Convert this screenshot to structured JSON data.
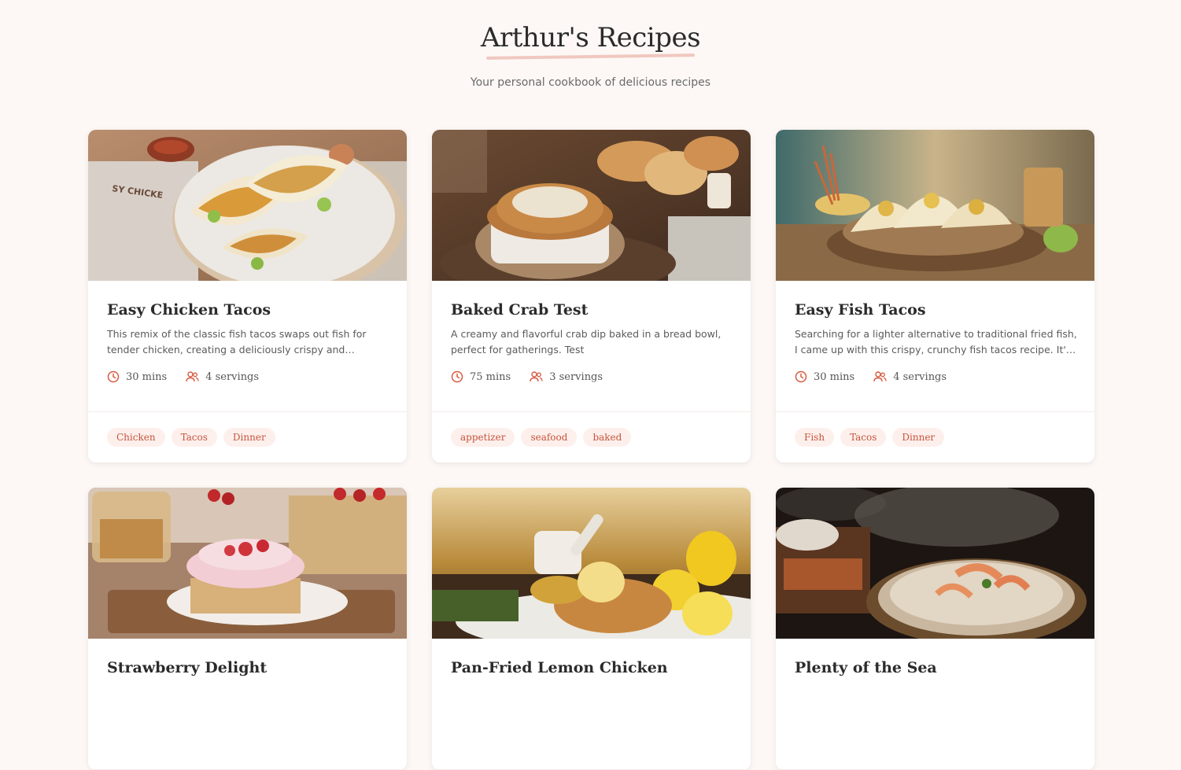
{
  "header": {
    "title": "Arthur's Recipes",
    "subtitle": "Your personal cookbook of delicious recipes"
  },
  "colors": {
    "background": "#fdf8f5",
    "accent": "#d65a3f",
    "tag_bg": "#fdf0ec",
    "underline": "#f0c8c0"
  },
  "icons": {
    "time": "clock-icon",
    "servings": "users-icon"
  },
  "recipes": [
    {
      "title": "Easy Chicken Tacos",
      "description": "This remix of the classic fish tacos swaps out fish for tender chicken, creating a deliciously crispy and crunchy...",
      "time": "30 mins",
      "servings": "4 servings",
      "tags": [
        "Chicken",
        "Tacos",
        "Dinner"
      ]
    },
    {
      "title": "Baked Crab Test",
      "description": "A creamy and flavorful crab dip baked in a bread bowl, perfect for gatherings. Test",
      "time": "75 mins",
      "servings": "3 servings",
      "tags": [
        "appetizer",
        "seafood",
        "baked"
      ]
    },
    {
      "title": "Easy Fish Tacos",
      "description": "Searching for a lighter alternative to traditional fried fish, I came up with this crispy, crunchy fish tacos recipe. It's a...",
      "time": "30 mins",
      "servings": "4 servings",
      "tags": [
        "Fish",
        "Tacos",
        "Dinner"
      ]
    },
    {
      "title": "Strawberry Delight"
    },
    {
      "title": "Pan-Fried Lemon Chicken"
    },
    {
      "title": "Plenty of the Sea"
    }
  ]
}
